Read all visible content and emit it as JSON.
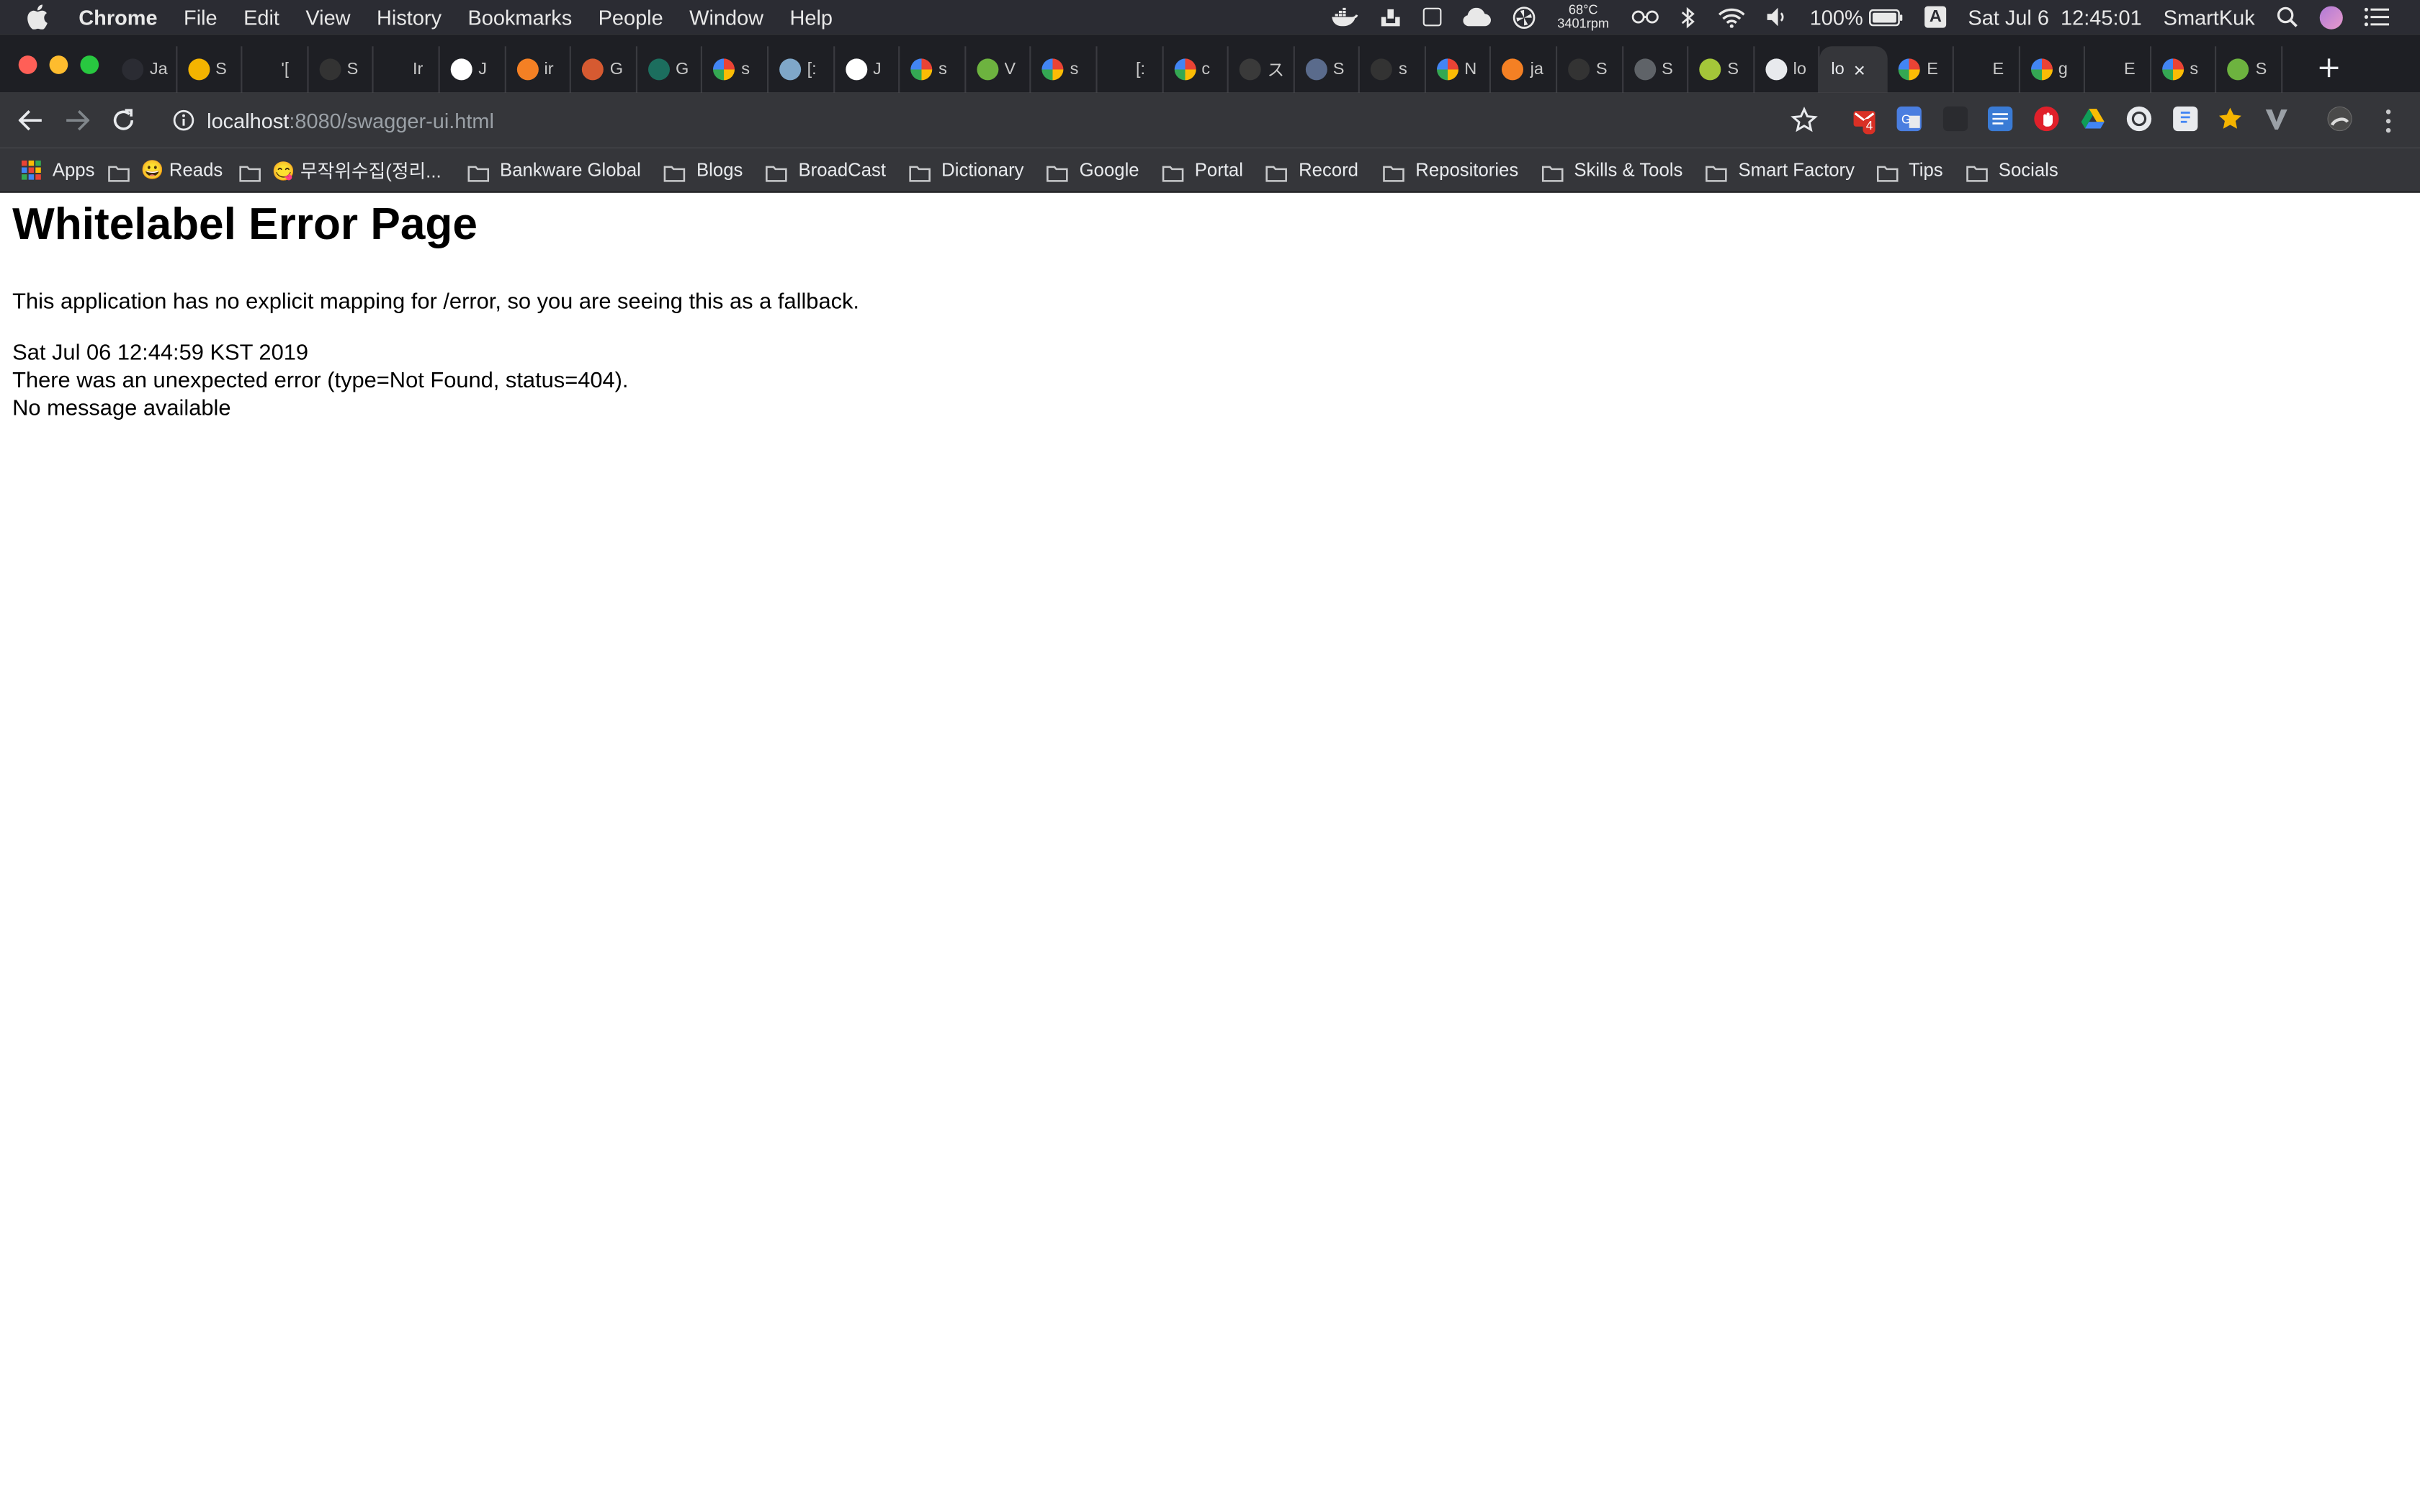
{
  "menubar": {
    "app_name": "Chrome",
    "items": [
      "File",
      "Edit",
      "View",
      "History",
      "Bookmarks",
      "People",
      "Window",
      "Help"
    ],
    "status": {
      "temperature": "68°C",
      "fan": "3401rpm",
      "battery": "100%",
      "input_source": "A",
      "datetime": "Sat Jul 6  12:45:01",
      "user": "SmartKuk"
    }
  },
  "tabs": [
    {
      "title": "Ja",
      "icon": "speaker-icon",
      "color": "#2b2c33"
    },
    {
      "title": "S",
      "icon": "slides-icon",
      "color": "#f4b400"
    },
    {
      "title": "'[",
      "icon": "blank-icon",
      "color": "#1e1f24"
    },
    {
      "title": "S",
      "icon": "github-icon",
      "color": "#333333"
    },
    {
      "title": "Ir",
      "icon": "blank-icon",
      "color": "#1e1f24"
    },
    {
      "title": "J",
      "icon": "medium-icon",
      "color": "#ffffff"
    },
    {
      "title": "ir",
      "icon": "stackoverflow-icon",
      "color": "#f48024"
    },
    {
      "title": "G",
      "icon": "lizard-icon",
      "color": "#d65a31"
    },
    {
      "title": "G",
      "icon": "dino-icon",
      "color": "#1c6e5e"
    },
    {
      "title": "s",
      "icon": "google-icon",
      "color": "#ffffff"
    },
    {
      "title": "[:",
      "icon": "grid-icon",
      "color": "#7fa7c9"
    },
    {
      "title": "J",
      "icon": "medium-icon",
      "color": "#ffffff"
    },
    {
      "title": "s",
      "icon": "google-icon",
      "color": "#ffffff"
    },
    {
      "title": "V",
      "icon": "spring-icon",
      "color": "#6db33f"
    },
    {
      "title": "s",
      "icon": "google-icon",
      "color": "#ffffff"
    },
    {
      "title": "[:",
      "icon": "blank-icon",
      "color": "#1e1f24"
    },
    {
      "title": "c",
      "icon": "google-icon",
      "color": "#ffffff"
    },
    {
      "title": "ス",
      "icon": "shield-icon",
      "color": "#3a3a3a"
    },
    {
      "title": "S",
      "icon": "helm-icon",
      "color": "#5a6b8c"
    },
    {
      "title": "s",
      "icon": "github-icon",
      "color": "#333333"
    },
    {
      "title": "N",
      "icon": "google-icon",
      "color": "#ffffff"
    },
    {
      "title": "ja",
      "icon": "stackoverflow-icon",
      "color": "#f48024"
    },
    {
      "title": "S",
      "icon": "github-icon",
      "color": "#333333"
    },
    {
      "title": "S",
      "icon": "globe-icon",
      "color": "#5f6368"
    },
    {
      "title": "S",
      "icon": "android-icon",
      "color": "#a4c639"
    },
    {
      "title": "lo",
      "icon": "globe-icon",
      "color": "#e8eaed"
    },
    {
      "title": "lo",
      "icon": "",
      "color": "",
      "active": true
    },
    {
      "title": "E",
      "icon": "google-icon",
      "color": "#ffffff"
    },
    {
      "title": "E",
      "icon": "blank-icon",
      "color": "#1e1f24"
    },
    {
      "title": "g",
      "icon": "google-icon",
      "color": "#ffffff"
    },
    {
      "title": "E",
      "icon": "blank-icon",
      "color": "#1e1f24"
    },
    {
      "title": "s",
      "icon": "google-icon",
      "color": "#ffffff"
    },
    {
      "title": "S",
      "icon": "spring-icon",
      "color": "#6db33f"
    }
  ],
  "toolbar": {
    "url_host": "localhost",
    "url_rest": ":8080/swagger-ui.html",
    "gmail_badge": "4"
  },
  "bookmarks": [
    {
      "label": "Apps",
      "kind": "apps-icon"
    },
    {
      "label": "😀 Reads",
      "kind": "folder-icon"
    },
    {
      "label": "😋 무작위수집(정리...",
      "kind": "folder-icon"
    },
    {
      "label": "Bankware Global",
      "kind": "folder-icon"
    },
    {
      "label": "Blogs",
      "kind": "folder-icon"
    },
    {
      "label": "BroadCast",
      "kind": "folder-icon"
    },
    {
      "label": "Dictionary",
      "kind": "folder-icon"
    },
    {
      "label": "Google",
      "kind": "folder-icon"
    },
    {
      "label": "Portal",
      "kind": "folder-icon"
    },
    {
      "label": "Record",
      "kind": "folder-icon"
    },
    {
      "label": "Repositories",
      "kind": "folder-icon"
    },
    {
      "label": "Skills & Tools",
      "kind": "folder-icon"
    },
    {
      "label": "Smart Factory",
      "kind": "folder-icon"
    },
    {
      "label": "Tips",
      "kind": "folder-icon"
    },
    {
      "label": "Socials",
      "kind": "folder-icon"
    }
  ],
  "page": {
    "heading": "Whitelabel Error Page",
    "message": "This application has no explicit mapping for /error, so you are seeing this as a fallback.",
    "timestamp": "Sat Jul 06 12:44:59 KST 2019",
    "error": "There was an unexpected error (type=Not Found, status=404).",
    "detail": "No message available"
  }
}
